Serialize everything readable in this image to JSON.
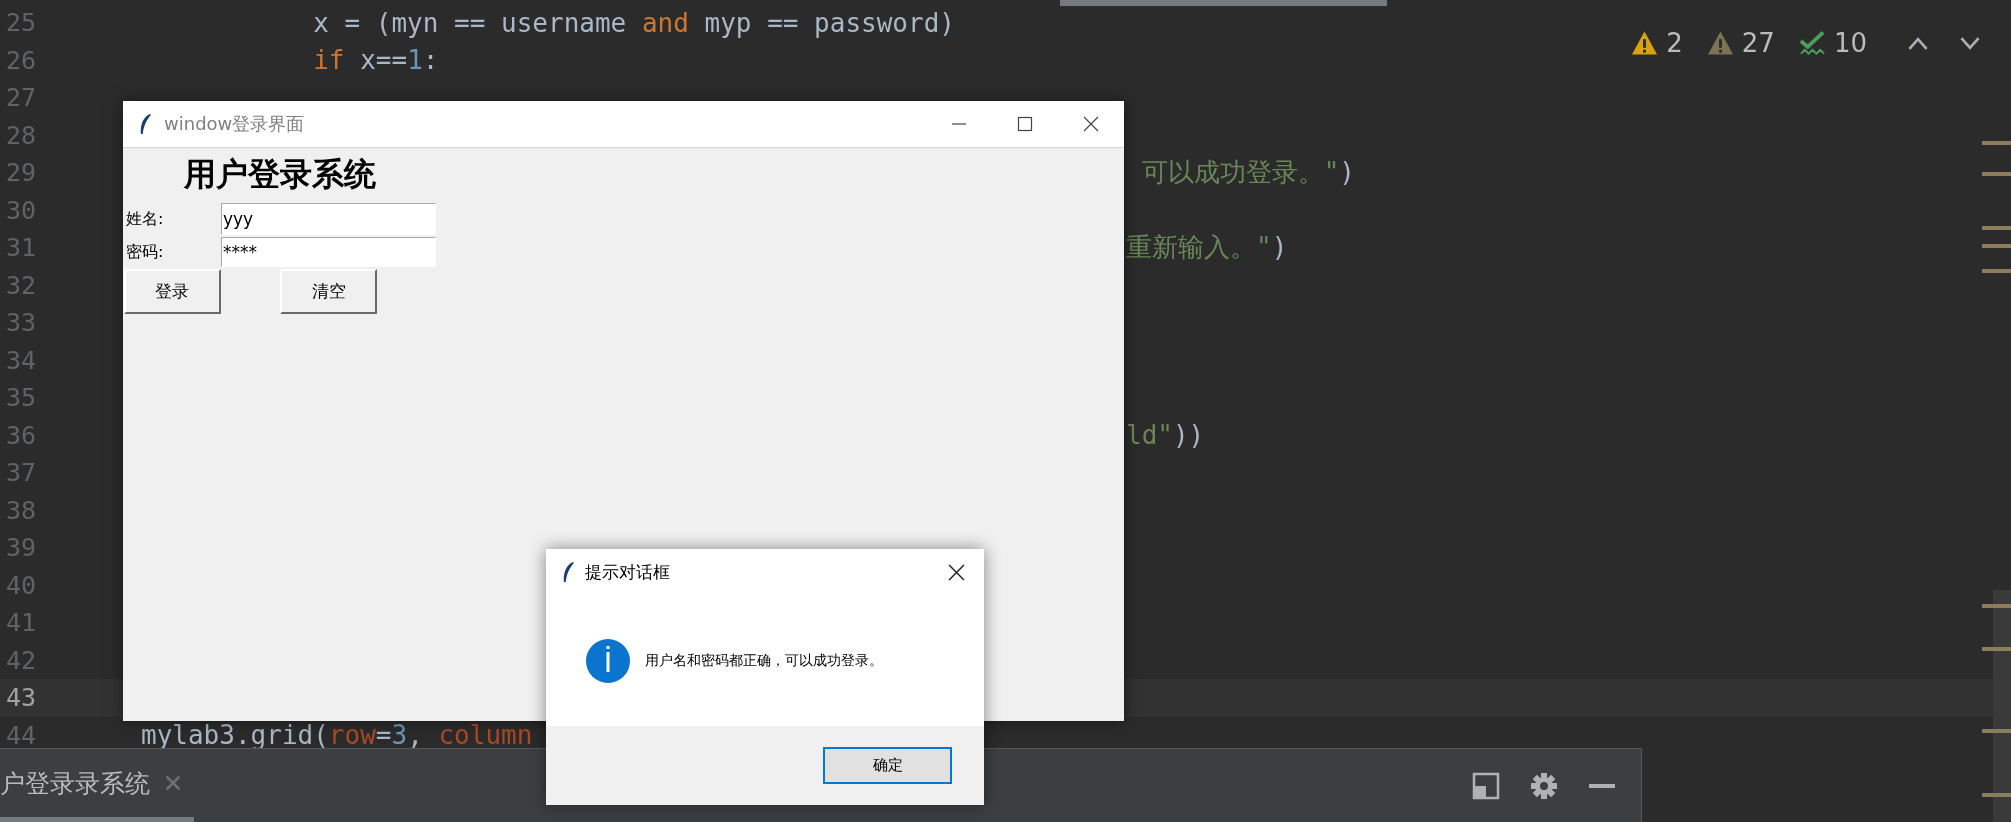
{
  "editor": {
    "lines": [
      {
        "number": "25",
        "current": false,
        "code": [
          {
            "kind": "plain",
            "text": "           x = (myn == username "
          },
          {
            "kind": "keyword",
            "text": "and"
          },
          {
            "kind": "plain",
            "text": " myp == password)"
          }
        ]
      },
      {
        "number": "26",
        "current": false,
        "code": [
          {
            "kind": "keyword",
            "text": "           if"
          },
          {
            "kind": "plain",
            "text": " x=="
          },
          {
            "kind": "number",
            "text": "1"
          },
          {
            "kind": "plain",
            "text": ":"
          }
        ]
      },
      {
        "number": "27",
        "current": false
      },
      {
        "number": "28",
        "current": false
      },
      {
        "number": "29",
        "current": false,
        "tail": [
          {
            "kind": "string",
            "text": " 可以成功登录。\""
          },
          {
            "kind": "plain",
            "text": ")"
          }
        ]
      },
      {
        "number": "30",
        "current": false
      },
      {
        "number": "31",
        "current": false,
        "tail": [
          {
            "kind": "string",
            "text": "重新输入。\""
          },
          {
            "kind": "plain",
            "text": ")"
          }
        ]
      },
      {
        "number": "32",
        "current": false
      },
      {
        "number": "33",
        "current": false
      },
      {
        "number": "34",
        "current": false
      },
      {
        "number": "35",
        "current": false
      },
      {
        "number": "36",
        "current": false,
        "tail": [
          {
            "kind": "string",
            "text": "ld\""
          },
          {
            "kind": "plain",
            "text": "))"
          }
        ]
      },
      {
        "number": "37",
        "current": false
      },
      {
        "number": "38",
        "current": false
      },
      {
        "number": "39",
        "current": false
      },
      {
        "number": "40",
        "current": false
      },
      {
        "number": "41",
        "current": false
      },
      {
        "number": "42",
        "current": false
      },
      {
        "number": "43",
        "current": true
      },
      {
        "number": "44",
        "current": false,
        "code": [
          {
            "kind": "plain",
            "text": "mylab3.grid("
          },
          {
            "kind": "param",
            "text": "row"
          },
          {
            "kind": "plain",
            "text": "="
          },
          {
            "kind": "number",
            "text": "3"
          },
          {
            "kind": "plain",
            "text": ", "
          },
          {
            "kind": "param",
            "text": "column"
          }
        ]
      }
    ]
  },
  "inspections": [
    {
      "kind": "warning",
      "count": "2"
    },
    {
      "kind": "weak_warning",
      "count": "27"
    },
    {
      "kind": "typo",
      "count": "10"
    }
  ],
  "tool_window": {
    "tab": {
      "label": "户登录录系统",
      "selected": true
    }
  },
  "login_window": {
    "title": "window登录界面",
    "heading": "用户登录系统",
    "fields": [
      {
        "label": "姓名:",
        "value": "yyy"
      },
      {
        "label": "密码:",
        "value": "****"
      }
    ],
    "buttons": [
      "登录",
      "清空"
    ]
  },
  "dialog": {
    "title": "提示对话框",
    "message": "用户名和密码都正确，可以成功登录。",
    "button": "确定"
  }
}
